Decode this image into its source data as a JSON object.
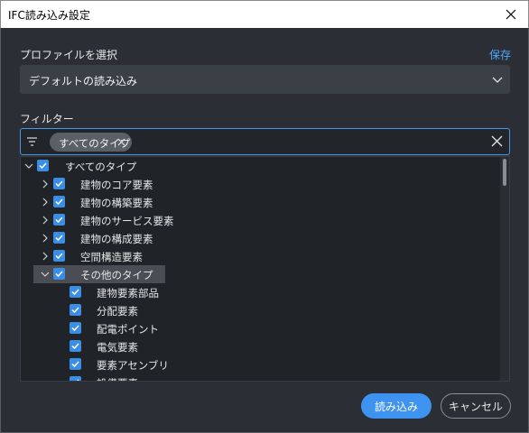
{
  "window": {
    "title": "IFC読み込み設定"
  },
  "profile": {
    "label": "プロファイルを選択",
    "save_link": "保存",
    "selected": "デフォルトの読み込み"
  },
  "filter": {
    "label": "フィルター",
    "chip": "すべてのタイプ"
  },
  "tree": {
    "items": [
      {
        "label": "すべてのタイプ",
        "level": 0,
        "expanded": true,
        "checked": true
      },
      {
        "label": "建物のコア要素",
        "level": 1,
        "expanded": false,
        "checked": true
      },
      {
        "label": "建物の構築要素",
        "level": 1,
        "expanded": false,
        "checked": true
      },
      {
        "label": "建物のサービス要素",
        "level": 1,
        "expanded": false,
        "checked": true
      },
      {
        "label": "建物の構成要素",
        "level": 1,
        "expanded": false,
        "checked": true
      },
      {
        "label": "空間構造要素",
        "level": 1,
        "expanded": false,
        "checked": true
      },
      {
        "label": "その他のタイプ",
        "level": 1,
        "expanded": true,
        "checked": true,
        "selected": true
      },
      {
        "label": "建物要素部品",
        "level": 2,
        "checked": true
      },
      {
        "label": "分配要素",
        "level": 2,
        "checked": true
      },
      {
        "label": "配電ポイント",
        "level": 2,
        "checked": true
      },
      {
        "label": "電気要素",
        "level": 2,
        "checked": true
      },
      {
        "label": "要素アセンブリ",
        "level": 2,
        "checked": true
      },
      {
        "label": "設備要素",
        "level": 2,
        "checked": true
      }
    ]
  },
  "buttons": {
    "import": "読み込み",
    "cancel": "キャンセル"
  },
  "colors": {
    "accent": "#3f93f0",
    "link": "#4ea7ff",
    "background": "#2b2e34",
    "checkbox": "#3b8ee6"
  },
  "icons": {
    "close": "close-icon",
    "dropdown": "chevron-down-icon",
    "filter": "filter-icon",
    "expand": "chevron-right-icon",
    "collapse": "chevron-down-icon"
  }
}
